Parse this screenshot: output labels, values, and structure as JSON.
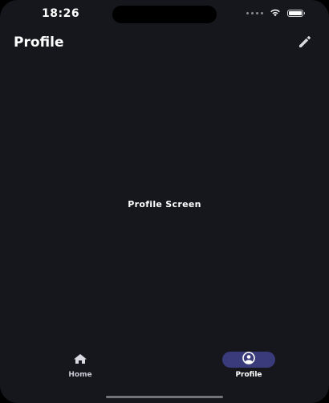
{
  "status_bar": {
    "time": "18:26",
    "icons": [
      "cellular-signal-icon",
      "wifi-icon",
      "battery-icon"
    ]
  },
  "header": {
    "title": "Profile",
    "edit_icon": "pencil-icon"
  },
  "main": {
    "label": "Profile Screen"
  },
  "bottom_nav": {
    "items": [
      {
        "label": "Home",
        "icon": "home-icon",
        "active": false
      },
      {
        "label": "Profile",
        "icon": "profile-icon",
        "active": true
      }
    ]
  },
  "colors": {
    "background": "#16171d",
    "active_pill": "#3a3b7a",
    "text": "#ffffff"
  }
}
